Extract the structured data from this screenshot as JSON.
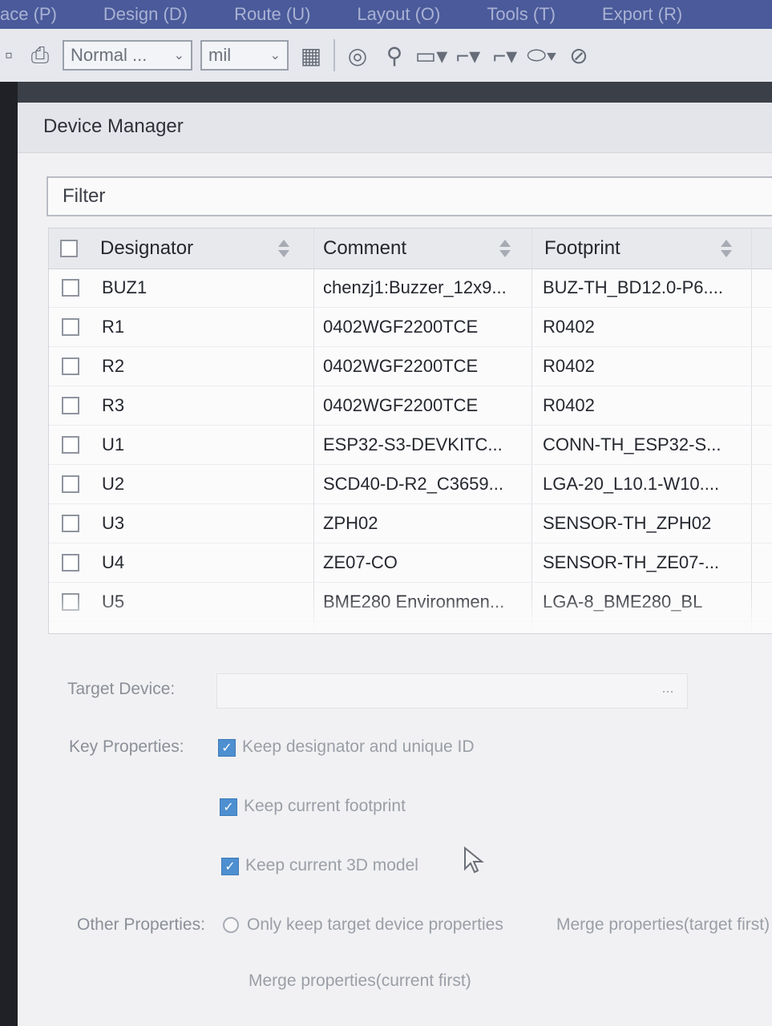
{
  "menubar": {
    "items": [
      "ace (P)",
      "Design (D)",
      "Route (U)",
      "Layout (O)",
      "Tools (T)",
      "Export (R)"
    ]
  },
  "toolbar": {
    "style_value": "Normal ...",
    "unit_value": "mil"
  },
  "dialog": {
    "title": "Device Manager",
    "filter_placeholder": "Filter",
    "columns": [
      "Designator",
      "Comment",
      "Footprint"
    ],
    "rows": [
      {
        "designator": "BUZ1",
        "comment": "chenzj1:Buzzer_12x9...",
        "footprint": "BUZ-TH_BD12.0-P6...."
      },
      {
        "designator": "R1",
        "comment": "0402WGF2200TCE",
        "footprint": "R0402"
      },
      {
        "designator": "R2",
        "comment": "0402WGF2200TCE",
        "footprint": "R0402"
      },
      {
        "designator": "R3",
        "comment": "0402WGF2200TCE",
        "footprint": "R0402"
      },
      {
        "designator": "U1",
        "comment": "ESP32-S3-DEVKITC...",
        "footprint": "CONN-TH_ESP32-S..."
      },
      {
        "designator": "U2",
        "comment": "SCD40-D-R2_C3659...",
        "footprint": "LGA-20_L10.1-W10...."
      },
      {
        "designator": "U3",
        "comment": "ZPH02",
        "footprint": "SENSOR-TH_ZPH02"
      },
      {
        "designator": "U4",
        "comment": "ZE07-CO",
        "footprint": "SENSOR-TH_ZE07-..."
      },
      {
        "designator": "U5",
        "comment": "BME280 Environmen...",
        "footprint": "LGA-8_BME280_BL"
      }
    ],
    "target_device_label": "Target Device:",
    "target_device_button": "...",
    "key_properties_label": "Key Properties:",
    "key_properties": [
      {
        "label": "Keep designator and unique ID",
        "checked": true
      },
      {
        "label": "Keep current footprint",
        "checked": true
      },
      {
        "label": "Keep current 3D model",
        "checked": true
      }
    ],
    "other_properties_label": "Other Properties:",
    "other_properties": [
      "Only keep target device properties",
      "Merge properties(target first)",
      "Merge properties(current first)"
    ]
  },
  "icons": [
    "grid-icon",
    "target-icon",
    "pin-icon",
    "rect-icon",
    "polyline-icon",
    "ellipse-icon",
    "no-entry-icon"
  ]
}
